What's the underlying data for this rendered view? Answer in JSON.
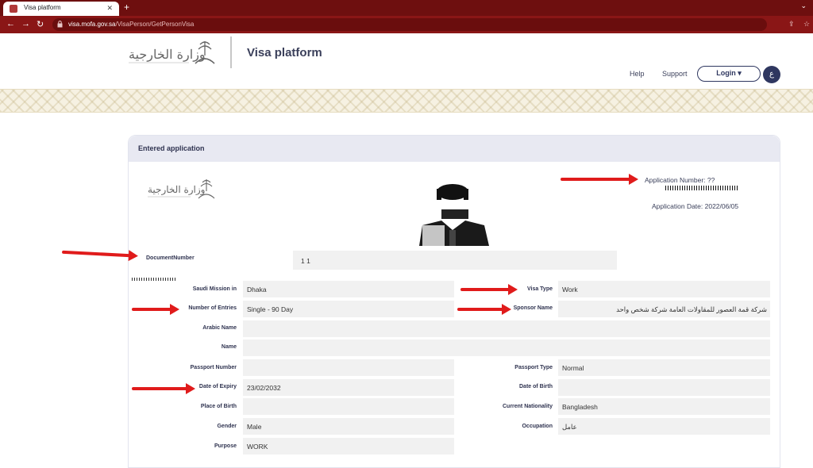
{
  "browser": {
    "tab_title": "Visa platform",
    "url_domain": "visa.mofa.gov.sa",
    "url_path": "/VisaPerson/GetPersonVisa"
  },
  "site": {
    "title": "Visa platform",
    "nav_help": "Help",
    "nav_support": "Support",
    "login_label": "Login ▾",
    "lang_label": "ع"
  },
  "card": {
    "title": "Entered application",
    "app_number_label": "Application Number:",
    "app_number_value": "??",
    "app_date": "Application Date: 2022/06/05",
    "document_number_label": "DocumentNumber",
    "document_number_value": "1           1"
  },
  "fields": {
    "saudi_mission": {
      "label": "Saudi Mission in",
      "value": "Dhaka"
    },
    "visa_type": {
      "label": "Visa Type",
      "value": "Work"
    },
    "entries": {
      "label": "Number of Entries",
      "value": "Single - 90 Day"
    },
    "sponsor": {
      "label": "Sponsor Name",
      "value": "شركة قمة العصور للمقاولات العامة شركة شخص واحد"
    },
    "arabic_name": {
      "label": "Arabic Name",
      "value": ""
    },
    "name": {
      "label": "Name",
      "value": ""
    },
    "passport_number": {
      "label": "Passport Number",
      "value": ""
    },
    "passport_type": {
      "label": "Passport Type",
      "value": "Normal"
    },
    "date_of_expiry": {
      "label": "Date of Expiry",
      "value": "23/02/2032"
    },
    "date_of_birth": {
      "label": "Date of Birth",
      "value": ""
    },
    "place_of_birth": {
      "label": "Place of Birth",
      "value": ""
    },
    "nationality": {
      "label": "Current Nationality",
      "value": "Bangladesh"
    },
    "gender": {
      "label": "Gender",
      "value": "Male"
    },
    "occupation": {
      "label": "Occupation",
      "value": "عامل"
    },
    "purpose": {
      "label": "Purpose",
      "value": "WORK"
    }
  },
  "colors": {
    "browser_tabbar": "#6e0f0f",
    "brand_navy": "#2f3760",
    "annotation_arrow": "#e01b1b"
  }
}
